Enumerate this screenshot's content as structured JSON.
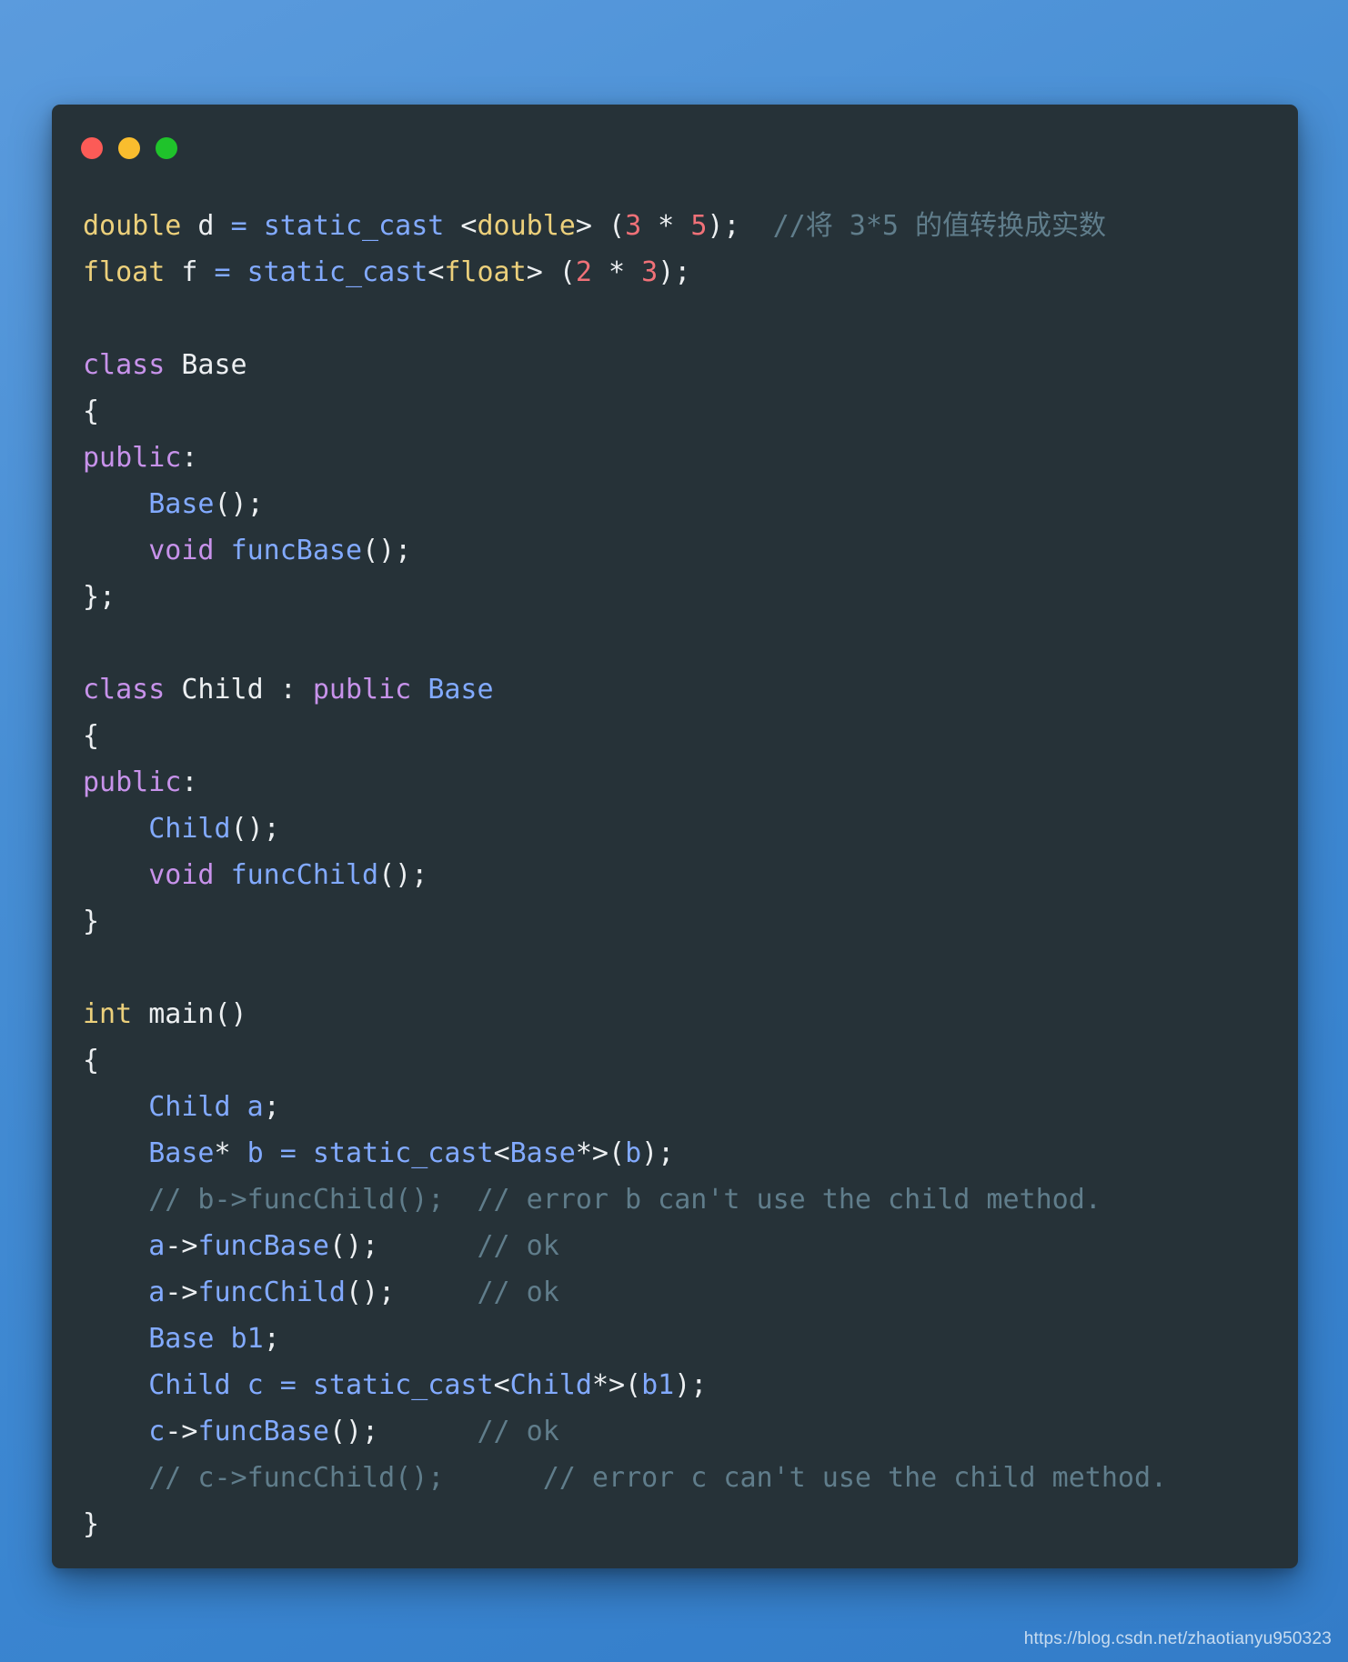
{
  "window": {
    "name": "carbon-code-snippet",
    "background_color": "#263238",
    "page_background": "#3f8ad4",
    "buttons": [
      {
        "name": "close",
        "label": "",
        "color": "#fc5b57"
      },
      {
        "name": "minimize",
        "label": "",
        "color": "#f9bd2e"
      },
      {
        "name": "maximize",
        "label": "",
        "color": "#1fc32b"
      }
    ]
  },
  "colors": {
    "type": "#ecd07b",
    "keyword": "#c792ea",
    "identifier": "#82aaff",
    "plain": "#eceff1",
    "number": "#f07178",
    "comment": "#607d8b"
  },
  "code": {
    "language": "cpp",
    "plain_text": "double d = static_cast <double> (3 * 5);  //将 3*5 的值转换成实数\nfloat f = static_cast<float> (2 * 3);\n\nclass Base\n{\npublic:\n    Base();\n    void funcBase();\n};\n\nclass Child : public Base\n{\npublic:\n    Child();\n    void funcChild();\n}\n\nint main()\n{\n    Child a;\n    Base* b = static_cast<Base*>(b);\n    // b->funcChild();  // error b can't use the child method.\n    a->funcBase();      // ok\n    a->funcChild();     // ok\n    Base b1;\n    Child c = static_cast<Child*>(b1);\n    c->funcBase();      // ok\n    // c->funcChild();      // error c can't use the child method.\n}",
    "lines": [
      {
        "n": 1,
        "tokens": [
          {
            "t": "double",
            "c": "type"
          },
          {
            "t": " d ",
            "c": "plain"
          },
          {
            "t": "=",
            "c": "ident"
          },
          {
            "t": " ",
            "c": "plain"
          },
          {
            "t": "static_cast",
            "c": "ident"
          },
          {
            "t": " <",
            "c": "plain"
          },
          {
            "t": "double",
            "c": "type"
          },
          {
            "t": "> (",
            "c": "plain"
          },
          {
            "t": "3",
            "c": "number"
          },
          {
            "t": " * ",
            "c": "plain"
          },
          {
            "t": "5",
            "c": "number"
          },
          {
            "t": ");  ",
            "c": "plain"
          },
          {
            "t": "//将 3*5 的值转换成实数",
            "c": "comment"
          }
        ]
      },
      {
        "n": 2,
        "tokens": [
          {
            "t": "float",
            "c": "type"
          },
          {
            "t": " f ",
            "c": "plain"
          },
          {
            "t": "=",
            "c": "ident"
          },
          {
            "t": " ",
            "c": "plain"
          },
          {
            "t": "static_cast",
            "c": "ident"
          },
          {
            "t": "<",
            "c": "plain"
          },
          {
            "t": "float",
            "c": "type"
          },
          {
            "t": "> (",
            "c": "plain"
          },
          {
            "t": "2",
            "c": "number"
          },
          {
            "t": " * ",
            "c": "plain"
          },
          {
            "t": "3",
            "c": "number"
          },
          {
            "t": ");",
            "c": "plain"
          }
        ]
      },
      {
        "n": 3,
        "tokens": [
          {
            "t": "",
            "c": "plain"
          }
        ]
      },
      {
        "n": 4,
        "tokens": [
          {
            "t": "class",
            "c": "keyword"
          },
          {
            "t": " Base",
            "c": "plain"
          }
        ]
      },
      {
        "n": 5,
        "tokens": [
          {
            "t": "{",
            "c": "plain"
          }
        ]
      },
      {
        "n": 6,
        "tokens": [
          {
            "t": "public",
            "c": "keyword"
          },
          {
            "t": ":",
            "c": "plain"
          }
        ]
      },
      {
        "n": 7,
        "tokens": [
          {
            "t": "    ",
            "c": "plain"
          },
          {
            "t": "Base",
            "c": "ident"
          },
          {
            "t": "();",
            "c": "plain"
          }
        ]
      },
      {
        "n": 8,
        "tokens": [
          {
            "t": "    ",
            "c": "plain"
          },
          {
            "t": "void",
            "c": "keyword"
          },
          {
            "t": " ",
            "c": "plain"
          },
          {
            "t": "funcBase",
            "c": "ident"
          },
          {
            "t": "();",
            "c": "plain"
          }
        ]
      },
      {
        "n": 9,
        "tokens": [
          {
            "t": "};",
            "c": "plain"
          }
        ]
      },
      {
        "n": 10,
        "tokens": [
          {
            "t": "",
            "c": "plain"
          }
        ]
      },
      {
        "n": 11,
        "tokens": [
          {
            "t": "class",
            "c": "keyword"
          },
          {
            "t": " Child : ",
            "c": "plain"
          },
          {
            "t": "public",
            "c": "keyword"
          },
          {
            "t": " ",
            "c": "plain"
          },
          {
            "t": "Base",
            "c": "ident"
          }
        ]
      },
      {
        "n": 12,
        "tokens": [
          {
            "t": "{",
            "c": "plain"
          }
        ]
      },
      {
        "n": 13,
        "tokens": [
          {
            "t": "public",
            "c": "keyword"
          },
          {
            "t": ":",
            "c": "plain"
          }
        ]
      },
      {
        "n": 14,
        "tokens": [
          {
            "t": "    ",
            "c": "plain"
          },
          {
            "t": "Child",
            "c": "ident"
          },
          {
            "t": "();",
            "c": "plain"
          }
        ]
      },
      {
        "n": 15,
        "tokens": [
          {
            "t": "    ",
            "c": "plain"
          },
          {
            "t": "void",
            "c": "keyword"
          },
          {
            "t": " ",
            "c": "plain"
          },
          {
            "t": "funcChild",
            "c": "ident"
          },
          {
            "t": "();",
            "c": "plain"
          }
        ]
      },
      {
        "n": 16,
        "tokens": [
          {
            "t": "}",
            "c": "plain"
          }
        ]
      },
      {
        "n": 17,
        "tokens": [
          {
            "t": "",
            "c": "plain"
          }
        ]
      },
      {
        "n": 18,
        "tokens": [
          {
            "t": "int",
            "c": "type"
          },
          {
            "t": " main()",
            "c": "plain"
          }
        ]
      },
      {
        "n": 19,
        "tokens": [
          {
            "t": "{",
            "c": "plain"
          }
        ]
      },
      {
        "n": 20,
        "tokens": [
          {
            "t": "    ",
            "c": "plain"
          },
          {
            "t": "Child",
            "c": "ident"
          },
          {
            "t": " a",
            "c": "ident"
          },
          {
            "t": ";",
            "c": "plain"
          }
        ]
      },
      {
        "n": 21,
        "tokens": [
          {
            "t": "    ",
            "c": "plain"
          },
          {
            "t": "Base",
            "c": "ident"
          },
          {
            "t": "* ",
            "c": "plain"
          },
          {
            "t": "b ",
            "c": "ident"
          },
          {
            "t": "= ",
            "c": "ident"
          },
          {
            "t": "static_cast",
            "c": "ident"
          },
          {
            "t": "<",
            "c": "plain"
          },
          {
            "t": "Base",
            "c": "ident"
          },
          {
            "t": "*>(",
            "c": "plain"
          },
          {
            "t": "b",
            "c": "ident"
          },
          {
            "t": ");",
            "c": "plain"
          }
        ]
      },
      {
        "n": 22,
        "tokens": [
          {
            "t": "    // b->funcChild();  // error b can't use the child method.",
            "c": "comment"
          }
        ]
      },
      {
        "n": 23,
        "tokens": [
          {
            "t": "    ",
            "c": "plain"
          },
          {
            "t": "a",
            "c": "ident"
          },
          {
            "t": "->",
            "c": "plain"
          },
          {
            "t": "funcBase",
            "c": "ident"
          },
          {
            "t": "();",
            "c": "plain"
          },
          {
            "t": "      ",
            "c": "plain"
          },
          {
            "t": "// ok",
            "c": "comment"
          }
        ]
      },
      {
        "n": 24,
        "tokens": [
          {
            "t": "    ",
            "c": "plain"
          },
          {
            "t": "a",
            "c": "ident"
          },
          {
            "t": "->",
            "c": "plain"
          },
          {
            "t": "funcChild",
            "c": "ident"
          },
          {
            "t": "();",
            "c": "plain"
          },
          {
            "t": "     ",
            "c": "plain"
          },
          {
            "t": "// ok",
            "c": "comment"
          }
        ]
      },
      {
        "n": 25,
        "tokens": [
          {
            "t": "    ",
            "c": "plain"
          },
          {
            "t": "Base",
            "c": "ident"
          },
          {
            "t": " b1",
            "c": "ident"
          },
          {
            "t": ";",
            "c": "plain"
          }
        ]
      },
      {
        "n": 26,
        "tokens": [
          {
            "t": "    ",
            "c": "plain"
          },
          {
            "t": "Child",
            "c": "ident"
          },
          {
            "t": " c ",
            "c": "ident"
          },
          {
            "t": "= ",
            "c": "ident"
          },
          {
            "t": "static_cast",
            "c": "ident"
          },
          {
            "t": "<",
            "c": "plain"
          },
          {
            "t": "Child",
            "c": "ident"
          },
          {
            "t": "*>(",
            "c": "plain"
          },
          {
            "t": "b1",
            "c": "ident"
          },
          {
            "t": ");",
            "c": "plain"
          }
        ]
      },
      {
        "n": 27,
        "tokens": [
          {
            "t": "    ",
            "c": "plain"
          },
          {
            "t": "c",
            "c": "ident"
          },
          {
            "t": "->",
            "c": "plain"
          },
          {
            "t": "funcBase",
            "c": "ident"
          },
          {
            "t": "();",
            "c": "plain"
          },
          {
            "t": "      ",
            "c": "plain"
          },
          {
            "t": "// ok",
            "c": "comment"
          }
        ]
      },
      {
        "n": 28,
        "tokens": [
          {
            "t": "    // c->funcChild();      // error c can't use the child method.",
            "c": "comment"
          }
        ]
      },
      {
        "n": 29,
        "tokens": [
          {
            "t": "}",
            "c": "plain"
          }
        ]
      }
    ]
  },
  "watermark": {
    "text": "https://blog.csdn.net/zhaotianyu950323"
  }
}
